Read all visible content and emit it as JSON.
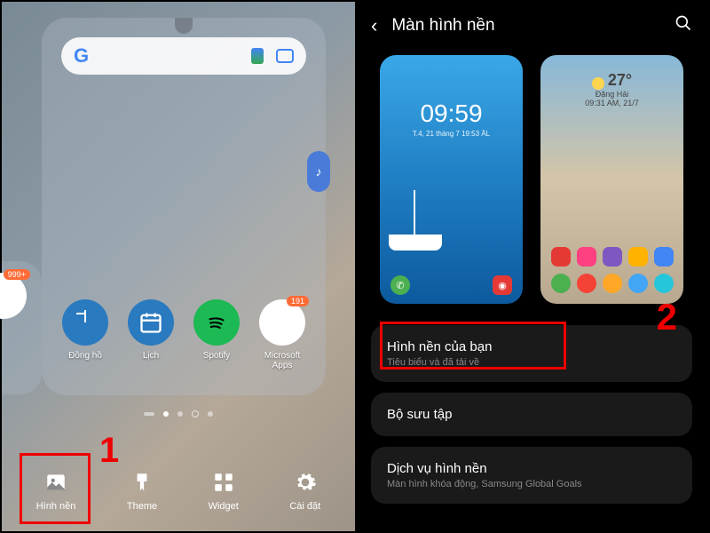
{
  "left": {
    "apps": {
      "clock": "Đồng hồ",
      "calendar": "Lịch",
      "spotify": "Spotify",
      "microsoft": "Microsoft Apps",
      "ms_badge": "191",
      "edge_badge": "999+"
    },
    "bottom": {
      "wallpaper": "Hình nền",
      "theme": "Theme",
      "widget": "Widget",
      "settings": "Cài đặt"
    },
    "callout": "1"
  },
  "right": {
    "title": "Màn hình nền",
    "lock": {
      "time": "09:59",
      "date": "T.4, 21 tháng 7 19:53 ÂL"
    },
    "weather": {
      "temp": "27°",
      "loc": "Đặng Hải",
      "time": "09:31 AM, 21/7"
    },
    "items": [
      {
        "title": "Hình nền của bạn",
        "sub": "Tiêu biểu và đã tải về"
      },
      {
        "title": "Bộ sưu tập",
        "sub": ""
      },
      {
        "title": "Dịch vụ hình nền",
        "sub": "Màn hình khóa động, Samsung Global Goals"
      }
    ],
    "callout": "2"
  }
}
